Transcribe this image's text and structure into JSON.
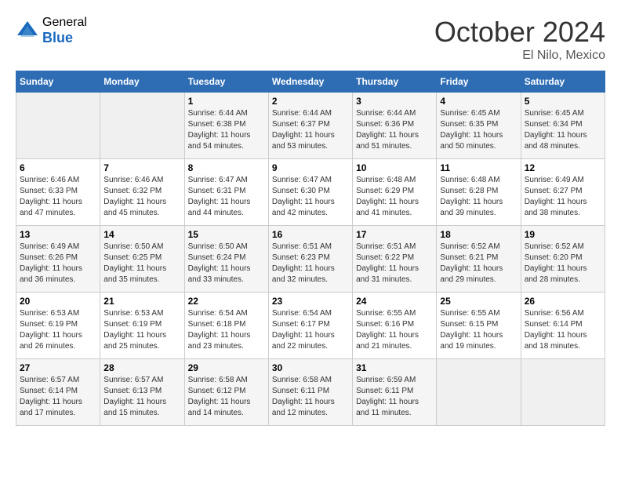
{
  "header": {
    "logo_general": "General",
    "logo_blue": "Blue",
    "month_title": "October 2024",
    "subtitle": "El Nilo, Mexico"
  },
  "weekdays": [
    "Sunday",
    "Monday",
    "Tuesday",
    "Wednesday",
    "Thursday",
    "Friday",
    "Saturday"
  ],
  "weeks": [
    [
      {
        "day": "",
        "content": ""
      },
      {
        "day": "",
        "content": ""
      },
      {
        "day": "1",
        "content": "Sunrise: 6:44 AM\nSunset: 6:38 PM\nDaylight: 11 hours and 54 minutes."
      },
      {
        "day": "2",
        "content": "Sunrise: 6:44 AM\nSunset: 6:37 PM\nDaylight: 11 hours and 53 minutes."
      },
      {
        "day": "3",
        "content": "Sunrise: 6:44 AM\nSunset: 6:36 PM\nDaylight: 11 hours and 51 minutes."
      },
      {
        "day": "4",
        "content": "Sunrise: 6:45 AM\nSunset: 6:35 PM\nDaylight: 11 hours and 50 minutes."
      },
      {
        "day": "5",
        "content": "Sunrise: 6:45 AM\nSunset: 6:34 PM\nDaylight: 11 hours and 48 minutes."
      }
    ],
    [
      {
        "day": "6",
        "content": "Sunrise: 6:46 AM\nSunset: 6:33 PM\nDaylight: 11 hours and 47 minutes."
      },
      {
        "day": "7",
        "content": "Sunrise: 6:46 AM\nSunset: 6:32 PM\nDaylight: 11 hours and 45 minutes."
      },
      {
        "day": "8",
        "content": "Sunrise: 6:47 AM\nSunset: 6:31 PM\nDaylight: 11 hours and 44 minutes."
      },
      {
        "day": "9",
        "content": "Sunrise: 6:47 AM\nSunset: 6:30 PM\nDaylight: 11 hours and 42 minutes."
      },
      {
        "day": "10",
        "content": "Sunrise: 6:48 AM\nSunset: 6:29 PM\nDaylight: 11 hours and 41 minutes."
      },
      {
        "day": "11",
        "content": "Sunrise: 6:48 AM\nSunset: 6:28 PM\nDaylight: 11 hours and 39 minutes."
      },
      {
        "day": "12",
        "content": "Sunrise: 6:49 AM\nSunset: 6:27 PM\nDaylight: 11 hours and 38 minutes."
      }
    ],
    [
      {
        "day": "13",
        "content": "Sunrise: 6:49 AM\nSunset: 6:26 PM\nDaylight: 11 hours and 36 minutes."
      },
      {
        "day": "14",
        "content": "Sunrise: 6:50 AM\nSunset: 6:25 PM\nDaylight: 11 hours and 35 minutes."
      },
      {
        "day": "15",
        "content": "Sunrise: 6:50 AM\nSunset: 6:24 PM\nDaylight: 11 hours and 33 minutes."
      },
      {
        "day": "16",
        "content": "Sunrise: 6:51 AM\nSunset: 6:23 PM\nDaylight: 11 hours and 32 minutes."
      },
      {
        "day": "17",
        "content": "Sunrise: 6:51 AM\nSunset: 6:22 PM\nDaylight: 11 hours and 31 minutes."
      },
      {
        "day": "18",
        "content": "Sunrise: 6:52 AM\nSunset: 6:21 PM\nDaylight: 11 hours and 29 minutes."
      },
      {
        "day": "19",
        "content": "Sunrise: 6:52 AM\nSunset: 6:20 PM\nDaylight: 11 hours and 28 minutes."
      }
    ],
    [
      {
        "day": "20",
        "content": "Sunrise: 6:53 AM\nSunset: 6:19 PM\nDaylight: 11 hours and 26 minutes."
      },
      {
        "day": "21",
        "content": "Sunrise: 6:53 AM\nSunset: 6:19 PM\nDaylight: 11 hours and 25 minutes."
      },
      {
        "day": "22",
        "content": "Sunrise: 6:54 AM\nSunset: 6:18 PM\nDaylight: 11 hours and 23 minutes."
      },
      {
        "day": "23",
        "content": "Sunrise: 6:54 AM\nSunset: 6:17 PM\nDaylight: 11 hours and 22 minutes."
      },
      {
        "day": "24",
        "content": "Sunrise: 6:55 AM\nSunset: 6:16 PM\nDaylight: 11 hours and 21 minutes."
      },
      {
        "day": "25",
        "content": "Sunrise: 6:55 AM\nSunset: 6:15 PM\nDaylight: 11 hours and 19 minutes."
      },
      {
        "day": "26",
        "content": "Sunrise: 6:56 AM\nSunset: 6:14 PM\nDaylight: 11 hours and 18 minutes."
      }
    ],
    [
      {
        "day": "27",
        "content": "Sunrise: 6:57 AM\nSunset: 6:14 PM\nDaylight: 11 hours and 17 minutes."
      },
      {
        "day": "28",
        "content": "Sunrise: 6:57 AM\nSunset: 6:13 PM\nDaylight: 11 hours and 15 minutes."
      },
      {
        "day": "29",
        "content": "Sunrise: 6:58 AM\nSunset: 6:12 PM\nDaylight: 11 hours and 14 minutes."
      },
      {
        "day": "30",
        "content": "Sunrise: 6:58 AM\nSunset: 6:11 PM\nDaylight: 11 hours and 12 minutes."
      },
      {
        "day": "31",
        "content": "Sunrise: 6:59 AM\nSunset: 6:11 PM\nDaylight: 11 hours and 11 minutes."
      },
      {
        "day": "",
        "content": ""
      },
      {
        "day": "",
        "content": ""
      }
    ]
  ]
}
